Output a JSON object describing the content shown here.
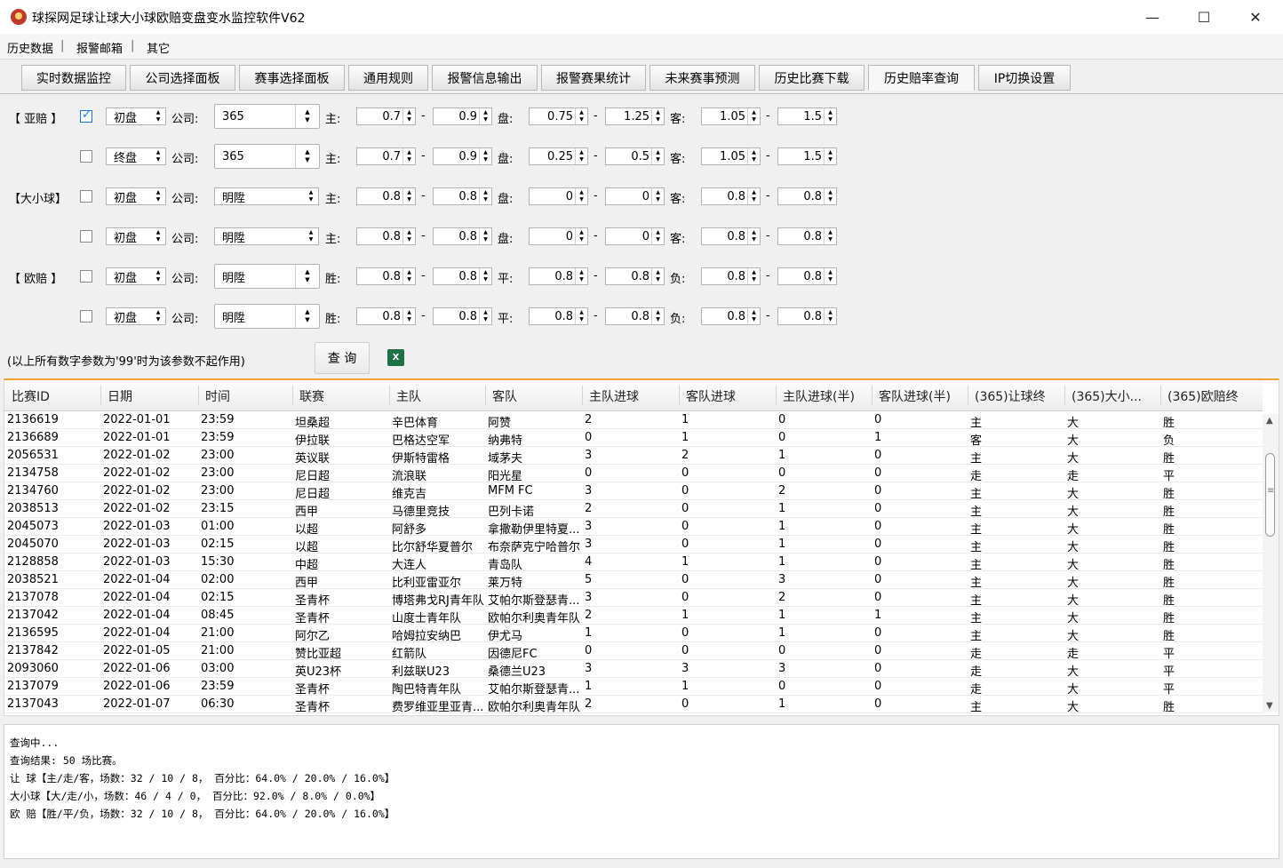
{
  "window": {
    "title": "球探网足球让球大小球欧赔变盘变水监控软件V62",
    "minimize": "—",
    "maximize": "☐",
    "close": "✕"
  },
  "menu": [
    "历史数据",
    "报警邮箱",
    "其它"
  ],
  "tabs": [
    {
      "label": "实时数据监控"
    },
    {
      "label": "公司选择面板"
    },
    {
      "label": "赛事选择面板"
    },
    {
      "label": "通用规则"
    },
    {
      "label": "报警信息输出"
    },
    {
      "label": "报警赛果统计"
    },
    {
      "label": "未来赛事预测"
    },
    {
      "label": "历史比赛下载"
    },
    {
      "label": "历史赔率查询"
    },
    {
      "label": "IP切换设置"
    }
  ],
  "filters": {
    "company_label": "公司:",
    "sections": [
      {
        "label": "【 亚赔 】",
        "rows": [
          {
            "checked": true,
            "type": "初盘",
            "company": "365",
            "l1": "主:",
            "a1": "0.7",
            "a2": "0.9",
            "l2": "盘:",
            "b1": "0.75",
            "b2": "1.25",
            "l3": "客:",
            "c1": "1.05",
            "c2": "1.5"
          },
          {
            "checked": false,
            "type": "终盘",
            "company": "365",
            "l1": "主:",
            "a1": "0.7",
            "a2": "0.9",
            "l2": "盘:",
            "b1": "0.25",
            "b2": "0.5",
            "l3": "客:",
            "c1": "1.05",
            "c2": "1.5"
          }
        ]
      },
      {
        "label": "【大小球】",
        "rows": [
          {
            "checked": false,
            "type": "初盘",
            "company": "明陞",
            "l1": "主:",
            "a1": "0.8",
            "a2": "0.8",
            "l2": "盘:",
            "b1": "0",
            "b2": "0",
            "l3": "客:",
            "c1": "0.8",
            "c2": "0.8"
          },
          {
            "checked": false,
            "type": "初盘",
            "company": "明陞",
            "l1": "主:",
            "a1": "0.8",
            "a2": "0.8",
            "l2": "盘:",
            "b1": "0",
            "b2": "0",
            "l3": "客:",
            "c1": "0.8",
            "c2": "0.8"
          }
        ]
      },
      {
        "label": "【 欧赔 】",
        "rows": [
          {
            "checked": false,
            "type": "初盘",
            "company": "明陞",
            "l1": "胜:",
            "a1": "0.8",
            "a2": "0.8",
            "l2": "平:",
            "b1": "0.8",
            "b2": "0.8",
            "l3": "负:",
            "c1": "0.8",
            "c2": "0.8"
          },
          {
            "checked": false,
            "type": "初盘",
            "company": "明陞",
            "l1": "胜:",
            "a1": "0.8",
            "a2": "0.8",
            "l2": "平:",
            "b1": "0.8",
            "b2": "0.8",
            "l3": "负:",
            "c1": "0.8",
            "c2": "0.8"
          }
        ]
      }
    ],
    "note": "(以上所有数字参数为'99'时为该参数不起作用)",
    "query_button": "查 询",
    "excel_icon": "X"
  },
  "table": {
    "columns": [
      "比赛ID",
      "日期",
      "时间",
      "联赛",
      "主队",
      "客队",
      "主队进球",
      "客队进球",
      "主队进球(半)",
      "客队进球(半)",
      "(365)让球终",
      "(365)大小...",
      "(365)欧赔终"
    ],
    "rows": [
      [
        "2136619",
        "2022-01-01",
        "23:59",
        "坦桑超",
        "辛巴体育",
        "阿赞",
        "2",
        "1",
        "0",
        "0",
        "主",
        "大",
        "胜"
      ],
      [
        "2136689",
        "2022-01-01",
        "23:59",
        "伊拉联",
        "巴格达空军",
        "纳弗特",
        "0",
        "1",
        "0",
        "1",
        "客",
        "大",
        "负"
      ],
      [
        "2056531",
        "2022-01-02",
        "23:00",
        "英议联",
        "伊斯特雷格",
        "域茅夫",
        "3",
        "2",
        "1",
        "0",
        "主",
        "大",
        "胜"
      ],
      [
        "2134758",
        "2022-01-02",
        "23:00",
        "尼日超",
        "流浪联",
        "阳光星",
        "0",
        "0",
        "0",
        "0",
        "走",
        "走",
        "平"
      ],
      [
        "2134760",
        "2022-01-02",
        "23:00",
        "尼日超",
        "维克吉",
        "MFM FC",
        "3",
        "0",
        "2",
        "0",
        "主",
        "大",
        "胜"
      ],
      [
        "2038513",
        "2022-01-02",
        "23:15",
        "西甲",
        "马德里竞技",
        "巴列卡诺",
        "2",
        "0",
        "1",
        "0",
        "主",
        "大",
        "胜"
      ],
      [
        "2045073",
        "2022-01-03",
        "01:00",
        "以超",
        "阿舒多",
        "拿撒勒伊里特夏...",
        "3",
        "0",
        "1",
        "0",
        "主",
        "大",
        "胜"
      ],
      [
        "2045070",
        "2022-01-03",
        "02:15",
        "以超",
        "比尔舒华夏普尔",
        "布奈萨克宁哈普尔",
        "3",
        "0",
        "1",
        "0",
        "主",
        "大",
        "胜"
      ],
      [
        "2128858",
        "2022-01-03",
        "15:30",
        "中超",
        "大连人",
        "青岛队",
        "4",
        "1",
        "1",
        "0",
        "主",
        "大",
        "胜"
      ],
      [
        "2038521",
        "2022-01-04",
        "02:00",
        "西甲",
        "比利亚雷亚尔",
        "莱万特",
        "5",
        "0",
        "3",
        "0",
        "主",
        "大",
        "胜"
      ],
      [
        "2137078",
        "2022-01-04",
        "02:15",
        "圣青杯",
        "博塔弗戈RJ青年队",
        "艾帕尔斯登瑟青...",
        "3",
        "0",
        "2",
        "0",
        "主",
        "大",
        "胜"
      ],
      [
        "2137042",
        "2022-01-04",
        "08:45",
        "圣青杯",
        "山度士青年队",
        "欧帕尔利奥青年队",
        "2",
        "1",
        "1",
        "1",
        "主",
        "大",
        "胜"
      ],
      [
        "2136595",
        "2022-01-04",
        "21:00",
        "阿尔乙",
        "哈姆拉安纳巴",
        "伊尤马",
        "1",
        "0",
        "1",
        "0",
        "主",
        "大",
        "胜"
      ],
      [
        "2137842",
        "2022-01-05",
        "21:00",
        "赞比亚超",
        "红箭队",
        "因德尼FC",
        "0",
        "0",
        "0",
        "0",
        "走",
        "走",
        "平"
      ],
      [
        "2093060",
        "2022-01-06",
        "03:00",
        "英U23杯",
        "利兹联U23",
        "桑德兰U23",
        "3",
        "3",
        "3",
        "0",
        "走",
        "大",
        "平"
      ],
      [
        "2137079",
        "2022-01-06",
        "23:59",
        "圣青杯",
        "陶巴特青年队",
        "艾帕尔斯登瑟青...",
        "1",
        "1",
        "0",
        "0",
        "走",
        "大",
        "平"
      ],
      [
        "2137043",
        "2022-01-07",
        "06:30",
        "圣青杯",
        "费罗维亚里亚青...",
        "欧帕尔利奥青年队",
        "2",
        "0",
        "1",
        "0",
        "主",
        "大",
        "胜"
      ]
    ]
  },
  "log": [
    "查询中...",
    "查询结果: 50 场比赛。",
    "让 球【主/走/客，场数：32 / 10 / 8， 百分比：64.0% / 20.0% / 16.0%】",
    "大小球【大/走/小，场数：46 / 4 / 0， 百分比：92.0% / 8.0% / 0.0%】",
    "欧 赔【胜/平/负，场数：32 / 10 / 8， 百分比：64.0% / 20.0% / 16.0%】"
  ]
}
